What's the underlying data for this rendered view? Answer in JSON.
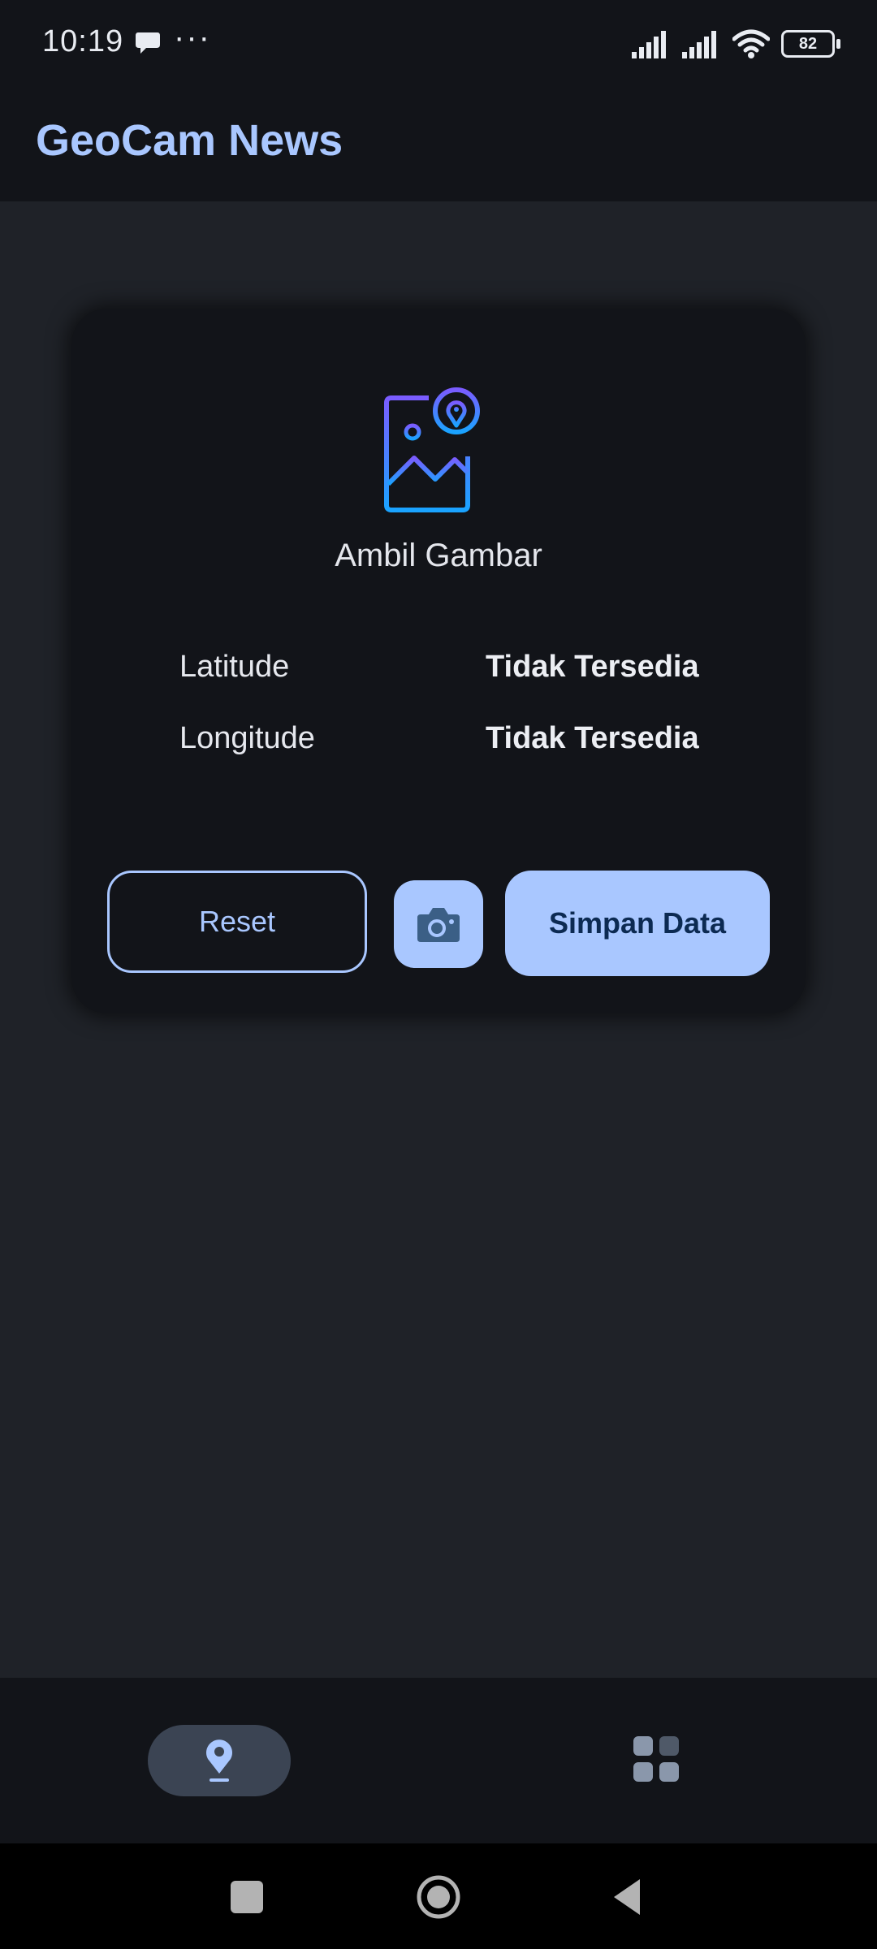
{
  "status_bar": {
    "time": "10:19",
    "more": "···",
    "battery_level": "82",
    "icons": [
      "chat-bubble-icon",
      "signal-icon",
      "signal-icon",
      "wifi-icon",
      "battery-icon"
    ]
  },
  "app_bar": {
    "title": "GeoCam News"
  },
  "card": {
    "hero_icon": "image-location-icon",
    "hero_label": "Ambil Gambar",
    "rows": [
      {
        "label": "Latitude",
        "value": "Tidak Tersedia"
      },
      {
        "label": "Longitude",
        "value": "Tidak Tersedia"
      }
    ],
    "reset_label": "Reset",
    "camera_icon": "camera-icon",
    "save_label": "Simpan Data"
  },
  "bottom_nav": {
    "items": [
      {
        "icon": "location-pin-icon",
        "selected": true
      },
      {
        "icon": "grid-icon",
        "selected": false
      }
    ]
  },
  "colors": {
    "accent": "#a9c7ff",
    "surface": "#121419",
    "background": "#1f2228",
    "nav_selected": "#3b4453"
  }
}
